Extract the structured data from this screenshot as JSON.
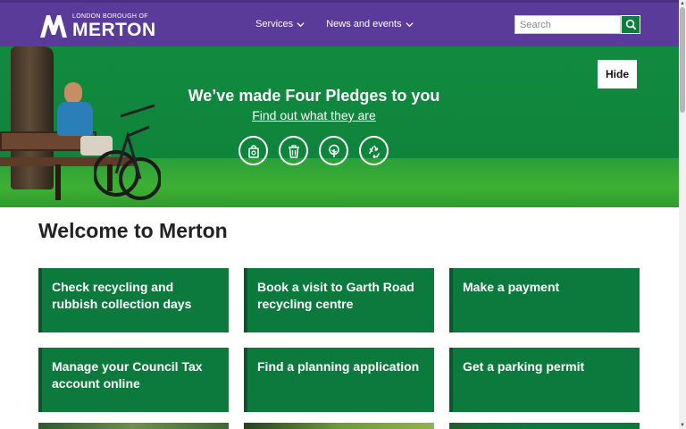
{
  "header": {
    "logo_small": "LONDON BOROUGH OF",
    "logo_big": "MERTON",
    "nav": [
      {
        "label": "Services",
        "icon": "chevron-down-icon"
      },
      {
        "label": "News and events",
        "icon": "chevron-down-icon"
      }
    ],
    "search": {
      "placeholder": "Search",
      "value": "",
      "icon": "search-icon"
    }
  },
  "hero": {
    "title": "We’ve made Four Pledges to you",
    "link": "Find out what they are",
    "hide_label": "Hide",
    "pledge_icons": [
      "shopping-bag-icon",
      "bin-icon",
      "tree-icon",
      "recycle-icon"
    ]
  },
  "main": {
    "heading": "Welcome to Merton",
    "tiles": [
      {
        "label": "Check recycling and rubbish collection days"
      },
      {
        "label": "Book a visit to Garth Road recycling centre"
      },
      {
        "label": "Make a payment"
      },
      {
        "label": "Manage your Council Tax account online"
      },
      {
        "label": "Find a planning application"
      },
      {
        "label": "Get a parking permit"
      }
    ]
  },
  "colors": {
    "header_purple": "#5b3b9a",
    "brand_green": "#0c7a3d",
    "hero_green": "#118a3f"
  }
}
